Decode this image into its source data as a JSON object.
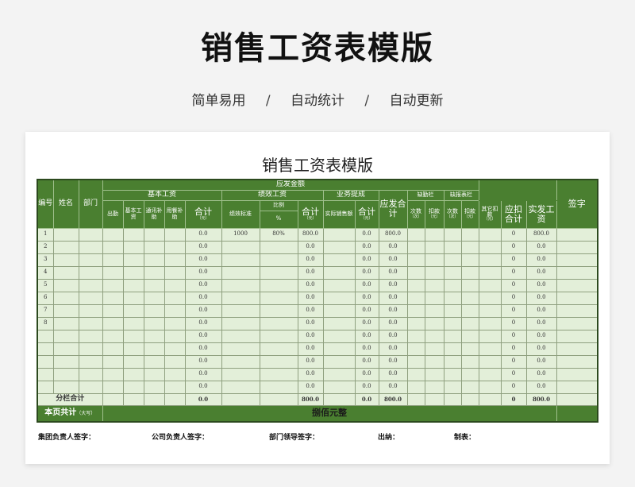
{
  "hero": {
    "title": "销售工资表模版",
    "tags": [
      "简单易用",
      "自动统计",
      "自动更新"
    ],
    "separator": "/"
  },
  "sheet": {
    "title": "销售工资表模版",
    "headers": {
      "id": "编号",
      "name": "姓名",
      "dept": "部门",
      "payable_amount": "应发金额",
      "basic_salary": "基本工资",
      "attendance": "出勤",
      "base": "基本工资",
      "comm_allow": "通讯补助",
      "meal_allow": "用餐补助",
      "subtotal": "合计",
      "unit_yuan": "（元）",
      "performance_salary": "绩效工资",
      "perf_standard": "绩效标准",
      "ratio": "比例",
      "percent": "%",
      "commission": "业务提成",
      "actual_sales": "实际销售额",
      "payable_total": "应发合计",
      "absence": "缺勤栏",
      "late_report": "缺报表栏",
      "times": "次数",
      "unit_times": "（次）",
      "deduction": "扣款",
      "other_deduction": "其它扣款",
      "deduct_total": "应扣合计",
      "net_pay": "实发工资",
      "signature": "签字"
    },
    "rows": [
      {
        "id": "1",
        "basic_total": "0.0",
        "perf_std": "1000",
        "ratio": "80%",
        "perf_total": "800.0",
        "comm_total": "0.0",
        "payable": "800.0",
        "deduct": "0",
        "net": "800.0"
      },
      {
        "id": "2",
        "basic_total": "0.0",
        "perf_std": "",
        "ratio": "",
        "perf_total": "0.0",
        "comm_total": "0.0",
        "payable": "0.0",
        "deduct": "0",
        "net": "0.0"
      },
      {
        "id": "3",
        "basic_total": "0.0",
        "perf_std": "",
        "ratio": "",
        "perf_total": "0.0",
        "comm_total": "0.0",
        "payable": "0.0",
        "deduct": "0",
        "net": "0.0"
      },
      {
        "id": "4",
        "basic_total": "0.0",
        "perf_std": "",
        "ratio": "",
        "perf_total": "0.0",
        "comm_total": "0.0",
        "payable": "0.0",
        "deduct": "0",
        "net": "0.0"
      },
      {
        "id": "5",
        "basic_total": "0.0",
        "perf_std": "",
        "ratio": "",
        "perf_total": "0.0",
        "comm_total": "0.0",
        "payable": "0.0",
        "deduct": "0",
        "net": "0.0"
      },
      {
        "id": "6",
        "basic_total": "0.0",
        "perf_std": "",
        "ratio": "",
        "perf_total": "0.0",
        "comm_total": "0.0",
        "payable": "0.0",
        "deduct": "0",
        "net": "0.0"
      },
      {
        "id": "7",
        "basic_total": "0.0",
        "perf_std": "",
        "ratio": "",
        "perf_total": "0.0",
        "comm_total": "0.0",
        "payable": "0.0",
        "deduct": "0",
        "net": "0.0"
      },
      {
        "id": "8",
        "basic_total": "0.0",
        "perf_std": "",
        "ratio": "",
        "perf_total": "0.0",
        "comm_total": "0.0",
        "payable": "0.0",
        "deduct": "0",
        "net": "0.0"
      },
      {
        "id": "",
        "basic_total": "0.0",
        "perf_std": "",
        "ratio": "",
        "perf_total": "0.0",
        "comm_total": "0.0",
        "payable": "0.0",
        "deduct": "0",
        "net": "0.0"
      },
      {
        "id": "",
        "basic_total": "0.0",
        "perf_std": "",
        "ratio": "",
        "perf_total": "0.0",
        "comm_total": "0.0",
        "payable": "0.0",
        "deduct": "0",
        "net": "0.0"
      },
      {
        "id": "",
        "basic_total": "0.0",
        "perf_std": "",
        "ratio": "",
        "perf_total": "0.0",
        "comm_total": "0.0",
        "payable": "0.0",
        "deduct": "0",
        "net": "0.0"
      },
      {
        "id": "",
        "basic_total": "0.0",
        "perf_std": "",
        "ratio": "",
        "perf_total": "0.0",
        "comm_total": "0.0",
        "payable": "0.0",
        "deduct": "0",
        "net": "0.0"
      },
      {
        "id": "",
        "basic_total": "0.0",
        "perf_std": "",
        "ratio": "",
        "perf_total": "0.0",
        "comm_total": "0.0",
        "payable": "0.0",
        "deduct": "0",
        "net": "0.0"
      }
    ],
    "subtotal": {
      "label": "分栏合计",
      "basic_total": "0.0",
      "perf_total": "800.0",
      "comm_total": "0.0",
      "payable": "800.0",
      "deduct": "0",
      "net": "800.0"
    },
    "page_total": {
      "label": "本页共计",
      "note": "（大写）",
      "amount_words": "捌佰元整"
    }
  },
  "signatures": [
    "集团负责人签字：",
    "公司负责人签字：",
    "部门领导签字：",
    "出纳：",
    "制表："
  ],
  "colors": {
    "header_green": "#4a7f30",
    "cell_green": "#e3efd9",
    "border_dark": "#2c4a1e"
  }
}
